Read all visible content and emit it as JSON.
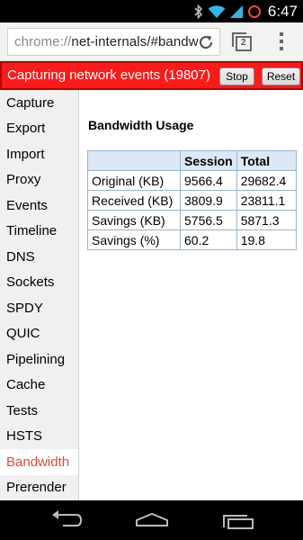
{
  "status_bar": {
    "time": "6:47",
    "icons": [
      "bluetooth-icon",
      "wifi-icon",
      "signal-icon",
      "battery-icon"
    ]
  },
  "browser": {
    "url_scheme": "chrome://",
    "url_rest": "net-internals/#bandw",
    "tab_count": "2"
  },
  "capture": {
    "status_text": "Capturing network events (19807)",
    "stop_label": "Stop",
    "reset_label": "Reset"
  },
  "sidebar": {
    "items": [
      {
        "label": "Capture"
      },
      {
        "label": "Export"
      },
      {
        "label": "Import"
      },
      {
        "label": "Proxy"
      },
      {
        "label": "Events"
      },
      {
        "label": "Timeline"
      },
      {
        "label": "DNS"
      },
      {
        "label": "Sockets"
      },
      {
        "label": "SPDY"
      },
      {
        "label": "QUIC"
      },
      {
        "label": "Pipelining"
      },
      {
        "label": "Cache"
      },
      {
        "label": "Tests"
      },
      {
        "label": "HSTS"
      },
      {
        "label": "Bandwidth"
      },
      {
        "label": "Prerender"
      }
    ],
    "active": "Bandwidth"
  },
  "main": {
    "title": "Bandwidth Usage",
    "table": {
      "headers": [
        "",
        "Session",
        "Total"
      ],
      "rows": [
        [
          "Original (KB)",
          "9566.4",
          "29682.4"
        ],
        [
          "Received (KB)",
          "3809.9",
          "23811.1"
        ],
        [
          "Savings (KB)",
          "5756.5",
          "5871.3"
        ],
        [
          "Savings (%)",
          "60.2",
          "19.8"
        ]
      ]
    }
  },
  "colors": {
    "capture_banner": "#ff1a1a",
    "active_nav_text": "#dd4b39",
    "table_header_bg": "#dde8f6"
  }
}
